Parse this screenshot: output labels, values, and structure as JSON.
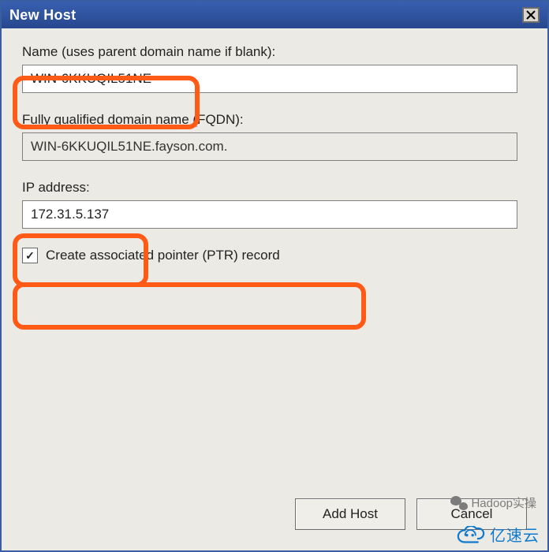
{
  "window": {
    "title": "New Host"
  },
  "labels": {
    "name": "Name (uses parent domain name if blank):",
    "fqdn": "Fully qualified domain name (FQDN):",
    "ip": "IP address:"
  },
  "values": {
    "name": "WIN-6KKUQIL51NE",
    "fqdn": "WIN-6KKUQIL51NE.fayson.com.",
    "ip": "172.31.5.137"
  },
  "checkbox": {
    "ptr_label": "Create associated pointer (PTR) record",
    "ptr_checked": "✓"
  },
  "buttons": {
    "add": "Add Host",
    "cancel": "Cancel"
  },
  "watermark": {
    "line1": "Hadoop实操",
    "line2": "亿速云"
  }
}
